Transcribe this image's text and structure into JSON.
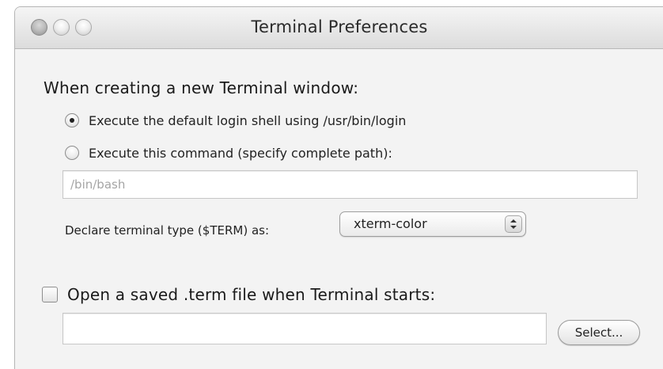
{
  "window": {
    "title": "Terminal Preferences"
  },
  "section": {
    "heading": "When creating a new Terminal window:"
  },
  "shell_options": [
    {
      "label": "Execute the default login shell using /usr/bin/login",
      "selected": true
    },
    {
      "label": "Execute this command (specify complete path):",
      "selected": false
    }
  ],
  "command_field": {
    "value": "/bin/bash"
  },
  "term_type": {
    "label": "Declare terminal type ($TERM) as:",
    "selected": "xterm-color"
  },
  "saved_term": {
    "checkbox_label": "Open a saved .term file when Terminal starts:",
    "checked": false,
    "path_value": "",
    "select_button": "Select..."
  }
}
